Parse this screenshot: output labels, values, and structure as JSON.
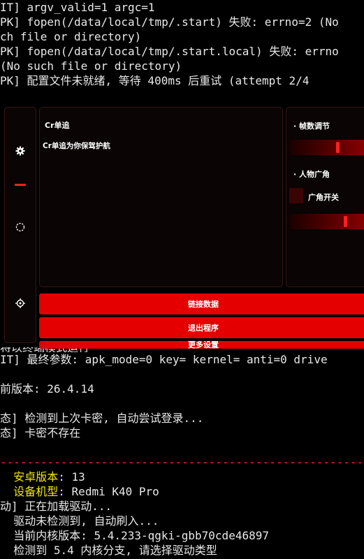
{
  "terminal_top": [
    {
      "text": "IT] argv_valid=1 argc=1"
    },
    {
      "text": "PK] fopen(/data/local/tmp/.start) 失败: errno=2 (No"
    },
    {
      "text": "ch file or directory)"
    },
    {
      "text": "PK] fopen(/data/local/tmp/.start.local) 失败: errno"
    },
    {
      "text": "(No such file or directory)"
    },
    {
      "text": "PK] 配置文件未就绪, 等待 400ms 后重试 (attempt 2/4"
    }
  ],
  "terminal_bottom": [
    {
      "text": "将以终端模式运行",
      "style": "partial"
    },
    {
      "text": "IT] 最终参数: apk_mode=0 key= kernel= anti=0 drive"
    },
    {
      "text": ""
    },
    {
      "text": "前版本: 26.4.14"
    },
    {
      "text": ""
    },
    {
      "text": "态] 检测到上次卡密, 自动尝试登录..."
    },
    {
      "text": "态] 卡密不存在"
    },
    {
      "text": ""
    },
    {
      "text": "-------------------------------------------------------",
      "style": "dash"
    },
    {
      "label": "  安卓版本",
      "value": ": 13"
    },
    {
      "label": "  设备机型",
      "value": ": Redmi K40 Pro"
    },
    {
      "text": "动] 正在加载驱动..."
    },
    {
      "text": "  驱动未检测到, 自动刷入..."
    },
    {
      "text": "  当前内核版本: 5.4.233-qgki-gbb70cde46897"
    },
    {
      "text": "  检测到 5.4 内核分支, 请选择驱动类型"
    }
  ],
  "overlay": {
    "main_title": "Cr单追",
    "main_subtitle": "Cr单追为你保驾护航",
    "right": {
      "section1_title": "· 帧数调节",
      "slider1_value": 0.64,
      "section2_title": "· 人物广角",
      "toggle_label": "广角开关",
      "slider2_value": 0.74
    },
    "buttons": {
      "connect": "链接数据",
      "exit": "退出程序",
      "third": "更多设置"
    },
    "colors": {
      "accent": "#e50000",
      "panel_border": "#3a1616"
    }
  }
}
